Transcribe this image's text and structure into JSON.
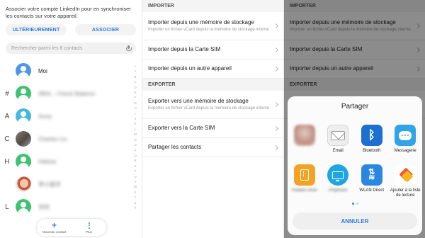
{
  "contacts_screen": {
    "banner_text": "Associer votre compte LinkedIn pour en synchroniser les contacts sur votre appareil.",
    "later_button": "ULTÉRIEUREMENT",
    "associate_button": "ASSOCIER",
    "search_placeholder": "Rechercher parmi les 6 contacts",
    "contacts": [
      {
        "letter": "",
        "name": "Moi",
        "avatar": "blue",
        "blurred": false
      },
      {
        "letter": "#",
        "name": "#BAL - Check Balance",
        "avatar": "green",
        "blurred": true
      },
      {
        "letter": "A",
        "name": "Anna",
        "avatar": "teal",
        "blurred": true
      },
      {
        "letter": "C",
        "name": "Charles Liu",
        "avatar": "photo1",
        "blurred": true
      },
      {
        "letter": "H",
        "name": "Hélène",
        "avatar": "green",
        "blurred": true
      },
      {
        "letter": "",
        "name": "李小姐华",
        "avatar": "photo2",
        "blurred": true
      },
      {
        "letter": "L",
        "name": "刘刘",
        "avatar": "green",
        "blurred": true
      }
    ],
    "index_letters": [
      "☆",
      "A",
      "B",
      "C",
      "D",
      "E",
      "F",
      "G",
      "H",
      "I",
      "J",
      "K",
      "L",
      "M",
      "N",
      "O",
      "P",
      "Q",
      "R",
      "S",
      "T",
      "U",
      "V",
      "W",
      "X",
      "Y",
      "Z",
      "#"
    ],
    "bottom_bar": {
      "new_contact": "Nouveau contact",
      "more": "Plus"
    }
  },
  "import_export_screen": {
    "import_header": "IMPORTER",
    "export_header": "EXPORTER",
    "import_items": [
      {
        "title": "Importer depuis une mémoire de stockage",
        "subtitle": "Importer un fichier vCard depuis la mémoire de stockage interne"
      },
      {
        "title": "Importer depuis la Carte SIM",
        "subtitle": ""
      },
      {
        "title": "Importer depuis un autre appareil",
        "subtitle": ""
      }
    ],
    "export_items": [
      {
        "title": "Exporter vers une mémoire de stockage",
        "subtitle": "Exporter un fichier vCard depuis la mémoire de stockage interne"
      },
      {
        "title": "Exporter vers la Carte SIM",
        "subtitle": ""
      },
      {
        "title": "Partager les contacts",
        "subtitle": ""
      }
    ]
  },
  "share_sheet": {
    "title": "Partager",
    "apps": [
      {
        "label": "",
        "icon": "blurred-app-icon"
      },
      {
        "label": "Email",
        "icon": "email-icon"
      },
      {
        "label": "Bluetooth",
        "icon": "bluetooth-icon"
      },
      {
        "label": "Messagerie",
        "icon": "messaging-icon"
      },
      {
        "label": "Huawei Drive",
        "icon": "drive-icon"
      },
      {
        "label": "Projection",
        "icon": "screen-share-icon"
      },
      {
        "label": "WLAN Direct",
        "icon": "wlan-direct-icon"
      },
      {
        "label": "Ajouter à la liste de lecture",
        "icon": "list-icon"
      }
    ],
    "cancel": "ANNULER"
  },
  "colors": {
    "accent": "#2f7bd9",
    "green": "#3fc270",
    "blue": "#4f95e8"
  }
}
